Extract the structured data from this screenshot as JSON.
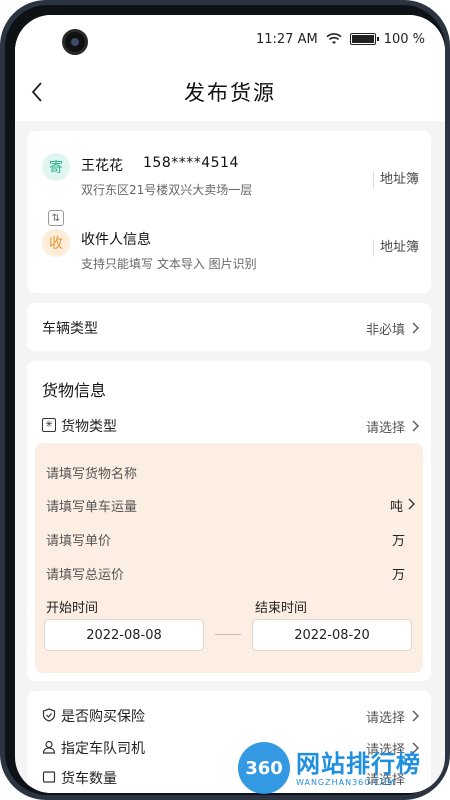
{
  "status_bar": {
    "time": "11:27 AM",
    "battery": "100 %"
  },
  "header": {
    "title": "发布货源"
  },
  "sender": {
    "badge": "寄",
    "name": "王花花",
    "phone": "158****4514",
    "address": "双行东区21号楼双兴大卖场一层",
    "address_book": "地址簿"
  },
  "receiver": {
    "badge": "收",
    "title": "收件人信息",
    "hint": "支持只能填写 文本导入 图片识别",
    "address_book": "地址簿"
  },
  "vehicle": {
    "label": "车辆类型",
    "value": "非必填"
  },
  "goods": {
    "section_title": "货物信息",
    "type_label": "货物类型",
    "type_value": "请选择",
    "fields": [
      {
        "placeholder": "请填写货物名称",
        "unit": ""
      },
      {
        "placeholder": "请填写单车运量",
        "unit": "吨"
      },
      {
        "placeholder": "请填写单价",
        "unit": "万"
      },
      {
        "placeholder": "请填写总运价",
        "unit": "万"
      }
    ],
    "start_label": "开始时间",
    "end_label": "结束时间",
    "start_date": "2022-08-08",
    "end_date": "2022-08-20"
  },
  "extras": [
    {
      "label": "是否购买保险",
      "value": "请选择",
      "icon": "shield-icon"
    },
    {
      "label": "指定车队司机",
      "value": "请选择",
      "icon": "person-icon"
    },
    {
      "label": "货车数量",
      "value": "请选择",
      "icon": "truck-count-icon"
    }
  ],
  "watermark": {
    "logo": "360",
    "text": "网站排行榜",
    "sub": "WANGZHAN360.COM"
  },
  "colors": {
    "accent_green": "#26b08c",
    "accent_orange": "#e79633",
    "panel_bg": "#fdeee4"
  }
}
